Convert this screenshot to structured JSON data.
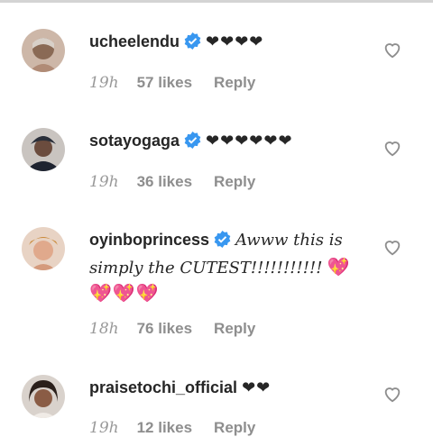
{
  "comments": [
    {
      "username": "ucheelendu",
      "text": "❤❤❤❤",
      "time": "19h",
      "likes": "57 likes",
      "reply": "Reply",
      "avatar_color": "#8a6a55"
    },
    {
      "username": "sotayogaga",
      "text": "❤❤❤❤❤❤",
      "time": "19h",
      "likes": "36 likes",
      "reply": "Reply",
      "avatar_color": "#2a2f3a"
    },
    {
      "username": "oyinboprincess",
      "text_line1": "Awww this is",
      "text_line2": "simply the CUTEST!!!!!!!!!!!",
      "emoji_inline": "💖",
      "emoji_row": "💖💖💖",
      "time": "18h",
      "likes": "76 likes",
      "reply": "Reply",
      "avatar_color": "#d49a7c"
    },
    {
      "username": "praisetochi_official",
      "text": "❤❤",
      "time": "19h",
      "likes": "12 likes",
      "reply": "Reply",
      "avatar_color": "#3a2c26"
    }
  ],
  "colors": {
    "verified_blue": "#3897f0",
    "meta_gray": "#8e8e8e",
    "text": "#262626",
    "heart_outline": "#8e8e8e"
  },
  "icons": {
    "verified": "verified-badge-icon",
    "like": "heart-outline-icon"
  }
}
